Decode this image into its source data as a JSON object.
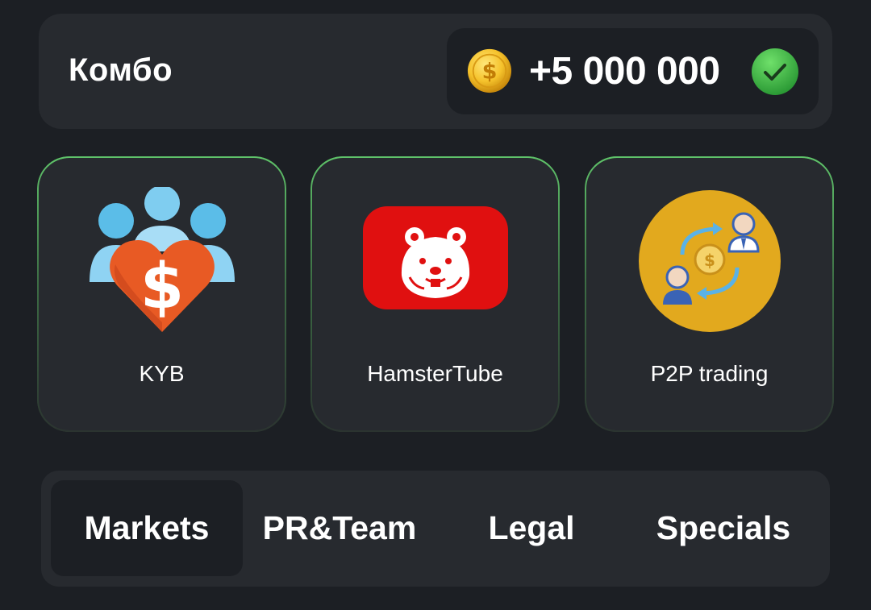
{
  "combo": {
    "title": "Комбо",
    "reward": "+5 000 000",
    "coin_icon": "coin-icon",
    "status_icon": "check-icon"
  },
  "cards": [
    {
      "label": "KYB",
      "icon": "heart-dollar-people-icon"
    },
    {
      "label": "HamsterTube",
      "icon": "hamster-tube-icon"
    },
    {
      "label": "P2P trading",
      "icon": "p2p-exchange-icon"
    }
  ],
  "tabs": [
    {
      "label": "Markets",
      "active": true
    },
    {
      "label": "PR&Team",
      "active": false
    },
    {
      "label": "Legal",
      "active": false
    },
    {
      "label": "Specials",
      "active": false
    }
  ],
  "colors": {
    "background": "#1c1f24",
    "panel": "#272a2f",
    "accent_green": "#5fc36a"
  }
}
